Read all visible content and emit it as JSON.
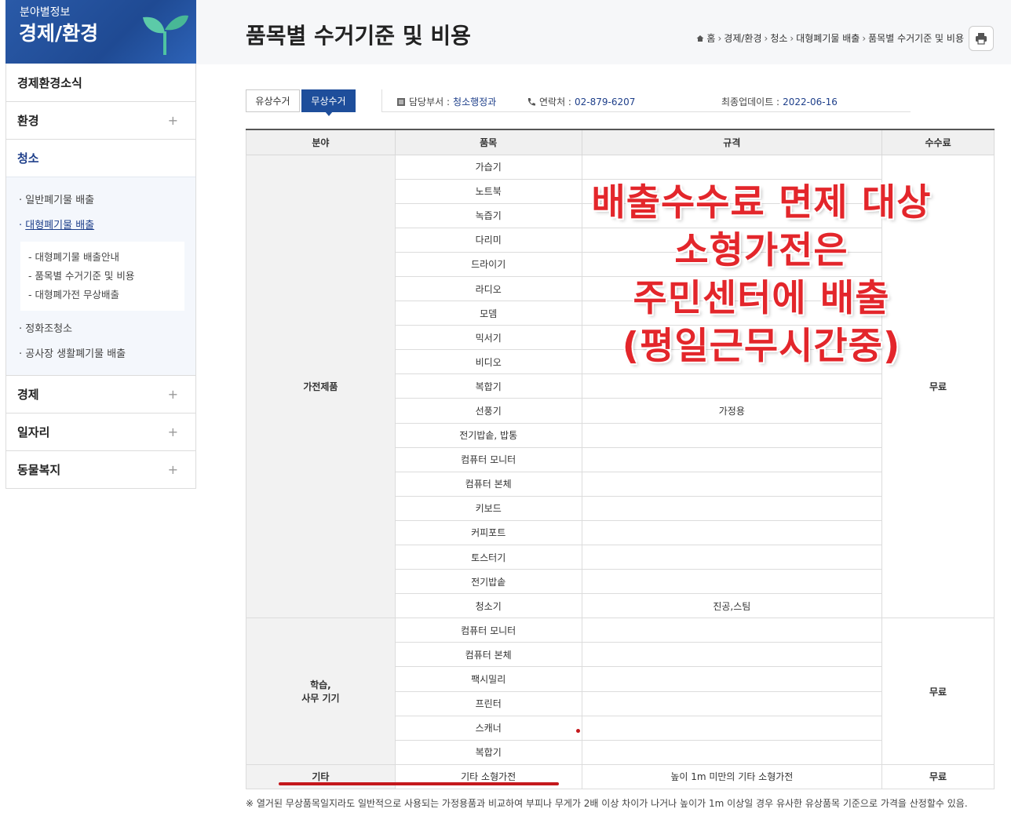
{
  "sidebar": {
    "header_sup": "분야별정보",
    "header_title": "경제/환경",
    "items": [
      {
        "label": "경제환경소식"
      },
      {
        "label": "환경",
        "expand": "+"
      },
      {
        "label": "청소"
      },
      {
        "label": "경제",
        "expand": "+"
      },
      {
        "label": "일자리",
        "expand": "+"
      },
      {
        "label": "동물복지",
        "expand": "+"
      }
    ],
    "cleaning_sub": [
      "일반폐기물 배출",
      "대형폐기물 배출",
      "정화조청소",
      "공사장 생활폐기물 배출"
    ],
    "large_waste_sub": [
      "대형폐기물 배출안내",
      "품목별 수거기준 및 비용",
      "대형폐가전 무상배출"
    ]
  },
  "header": {
    "title": "품목별 수거기준 및 비용",
    "breadcrumb": [
      "홈",
      "경제/환경",
      "청소",
      "대형폐기물 배출",
      "품목별 수거기준 및 비용"
    ]
  },
  "tabs": [
    "유상수거",
    "무상수거"
  ],
  "active_tab": "무상수거",
  "info": {
    "dept_label": "담당부서 :",
    "dept_value": "청소행정과",
    "contact_label": "연락처 :",
    "contact_value": "02-879-6207",
    "updated_label": "최종업데이트 :",
    "updated_value": "2022-06-16"
  },
  "table": {
    "headers": [
      "분야",
      "품목",
      "규격",
      "수수료"
    ],
    "groups": [
      {
        "category": "가전제품",
        "fee": "무료",
        "rows": [
          {
            "item": "가습기",
            "spec": ""
          },
          {
            "item": "노트북",
            "spec": ""
          },
          {
            "item": "녹즙기",
            "spec": ""
          },
          {
            "item": "다리미",
            "spec": ""
          },
          {
            "item": "드라이기",
            "spec": ""
          },
          {
            "item": "라디오",
            "spec": ""
          },
          {
            "item": "모뎀",
            "spec": ""
          },
          {
            "item": "믹서기",
            "spec": ""
          },
          {
            "item": "비디오",
            "spec": ""
          },
          {
            "item": "복합기",
            "spec": ""
          },
          {
            "item": "선풍기",
            "spec": "가정용"
          },
          {
            "item": "전기밥솥, 밥통",
            "spec": ""
          },
          {
            "item": "컴퓨터 모니터",
            "spec": ""
          },
          {
            "item": "컴퓨터 본체",
            "spec": ""
          },
          {
            "item": "키보드",
            "spec": ""
          },
          {
            "item": "커피포트",
            "spec": ""
          },
          {
            "item": "토스터기",
            "spec": ""
          },
          {
            "item": "전기밥솥",
            "spec": ""
          },
          {
            "item": "청소기",
            "spec": "진공,스팀"
          }
        ]
      },
      {
        "category_line1": "학습,",
        "category_line2": "사무 기기",
        "fee": "무료",
        "rows": [
          {
            "item": "컴퓨터 모니터",
            "spec": ""
          },
          {
            "item": "컴퓨터 본체",
            "spec": ""
          },
          {
            "item": "팩시밀리",
            "spec": ""
          },
          {
            "item": "프린터",
            "spec": ""
          },
          {
            "item": "스캐너",
            "spec": ""
          },
          {
            "item": "복합기",
            "spec": ""
          }
        ]
      },
      {
        "category": "기타",
        "fee": "무료",
        "rows": [
          {
            "item": "기타 소형가전",
            "spec": "높이 1m 미만의 기타 소형가전"
          }
        ]
      }
    ]
  },
  "note": "※ 열거된 무상품목일지라도 일반적으로 사용되는 가정용품과 비교하여 부피나 무게가 2배 이상 차이가 나거나 높이가 1m 이상일 경우 유사한 유상품목 기준으로 가격을 산정할수 있음.",
  "annotation": {
    "lines": [
      "배출수수료  면제  대상",
      "소형가전은",
      "주민센터에  배출",
      "(평일근무시간중)"
    ],
    "color": "#e3262b"
  },
  "colors": {
    "brand": "#1e4e9b",
    "accent_dark": "#1e3f8a"
  }
}
